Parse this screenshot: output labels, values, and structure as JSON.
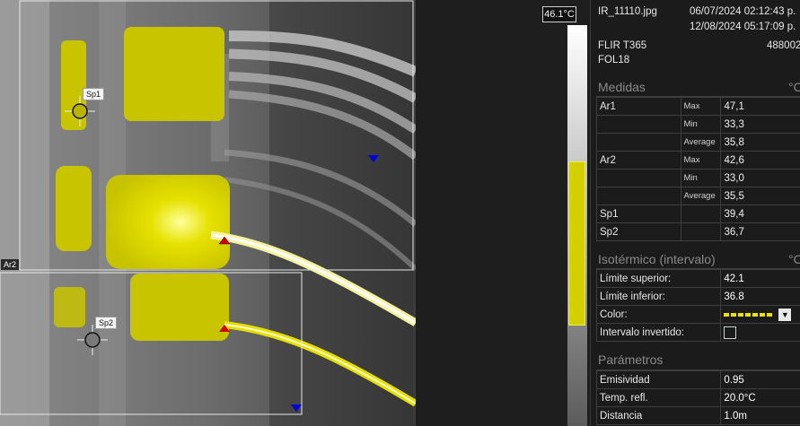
{
  "image": {
    "labels": {
      "sp1": "Sp1",
      "sp2": "Sp2",
      "ar2": "Ar2"
    }
  },
  "scale": {
    "max_label": "46.1°C"
  },
  "file": {
    "name": "IR_11110.jpg",
    "date_taken": "06/07/2024 02:12:43 p.",
    "date_modified": "12/08/2024 05:17:09 p.",
    "camera": "FLIR T365",
    "serial": "488002",
    "lens": "FOL18"
  },
  "measurements": {
    "title": "Medidas",
    "unit": "°C",
    "rows": [
      {
        "name": "Ar1",
        "stat": "Max",
        "value": "47,1"
      },
      {
        "name": "",
        "stat": "Min",
        "value": "33,3"
      },
      {
        "name": "",
        "stat": "Average",
        "value": "35,8"
      },
      {
        "name": "Ar2",
        "stat": "Max",
        "value": "42,6"
      },
      {
        "name": "",
        "stat": "Min",
        "value": "33,0"
      },
      {
        "name": "",
        "stat": "Average",
        "value": "35,5"
      },
      {
        "name": "Sp1",
        "stat": "",
        "value": "39,4"
      },
      {
        "name": "Sp2",
        "stat": "",
        "value": "36,7"
      }
    ]
  },
  "isotherm": {
    "title": "Isotérmico (intervalo)",
    "unit": "°C",
    "upper_label": "Límite superior:",
    "upper_value": "42.1",
    "lower_label": "Límite inferior:",
    "lower_value": "36.8",
    "color_label": "Color:",
    "color": "#e8e300",
    "inverted_label": "Intervalo invertido:"
  },
  "parameters": {
    "title": "Parámetros",
    "emissivity_label": "Emisividad",
    "emissivity_value": "0.95",
    "refl_label": "Temp. refl.",
    "refl_value": "20.0°C",
    "distance_label": "Distancia",
    "distance_value": "1.0m"
  }
}
